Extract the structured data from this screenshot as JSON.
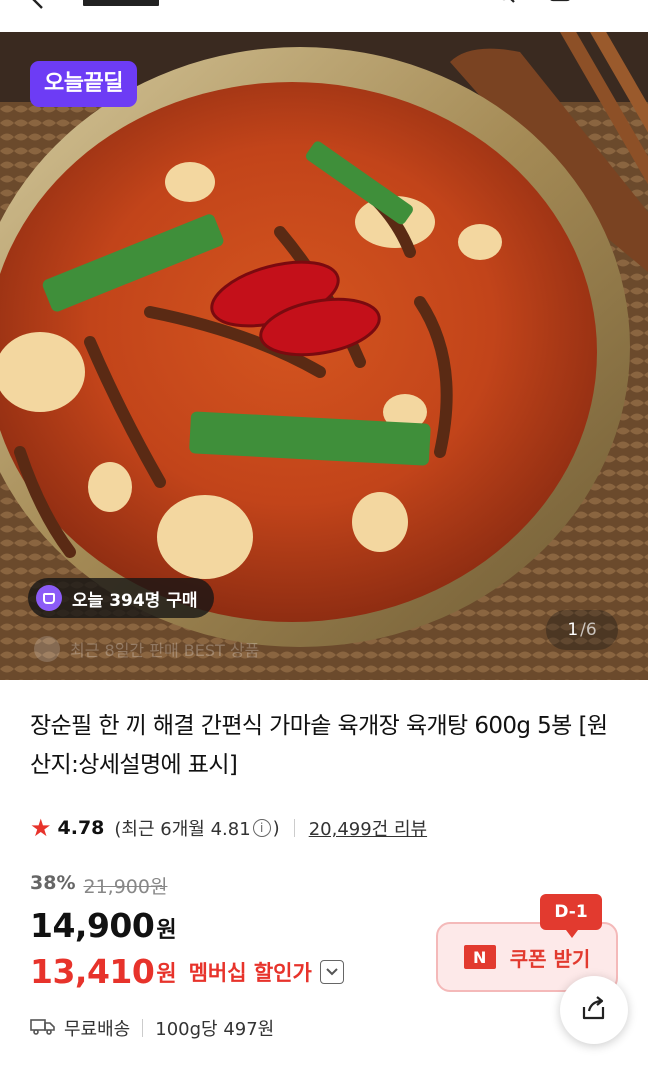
{
  "hero": {
    "deal_badge": "오늘끝딜",
    "purchase_count": "오늘 394명 구매",
    "best_caption": "최근 8일간 판매 BEST 상품",
    "pager_current": "1",
    "pager_total": "/6"
  },
  "product": {
    "title": "장순필 한 끼 해결 간편식 가마솥 육개장 육개탕 600g 5봉 [원산지:상세설명에 표시]",
    "rating": {
      "score": "4.78",
      "recent_label": "(최근 6개월 4.81",
      "recent_close": ")",
      "info_symbol": "i",
      "reviews": "20,499건 리뷰"
    },
    "discount_percent": "38%",
    "original_price": "21,900원",
    "price": "14,900",
    "price_unit": "원",
    "member_price": "13,410",
    "member_price_unit": "원",
    "member_label": "멤버십 할인가"
  },
  "coupon": {
    "badge": "D-1",
    "n_logo": "N",
    "label": "쿠폰 받기"
  },
  "delivery": {
    "shipping": "무료배송",
    "unit_price": "100g당 497원"
  },
  "colors": {
    "accent_red": "#e23a2f",
    "deal_purple": "#6d3cf5"
  },
  "icons": [
    "back-arrow-icon",
    "search-icon",
    "cart-icon",
    "menu-icon",
    "shopping-bag-icon",
    "star-icon",
    "info-icon",
    "chevron-down-icon",
    "share-icon",
    "truck-icon"
  ]
}
